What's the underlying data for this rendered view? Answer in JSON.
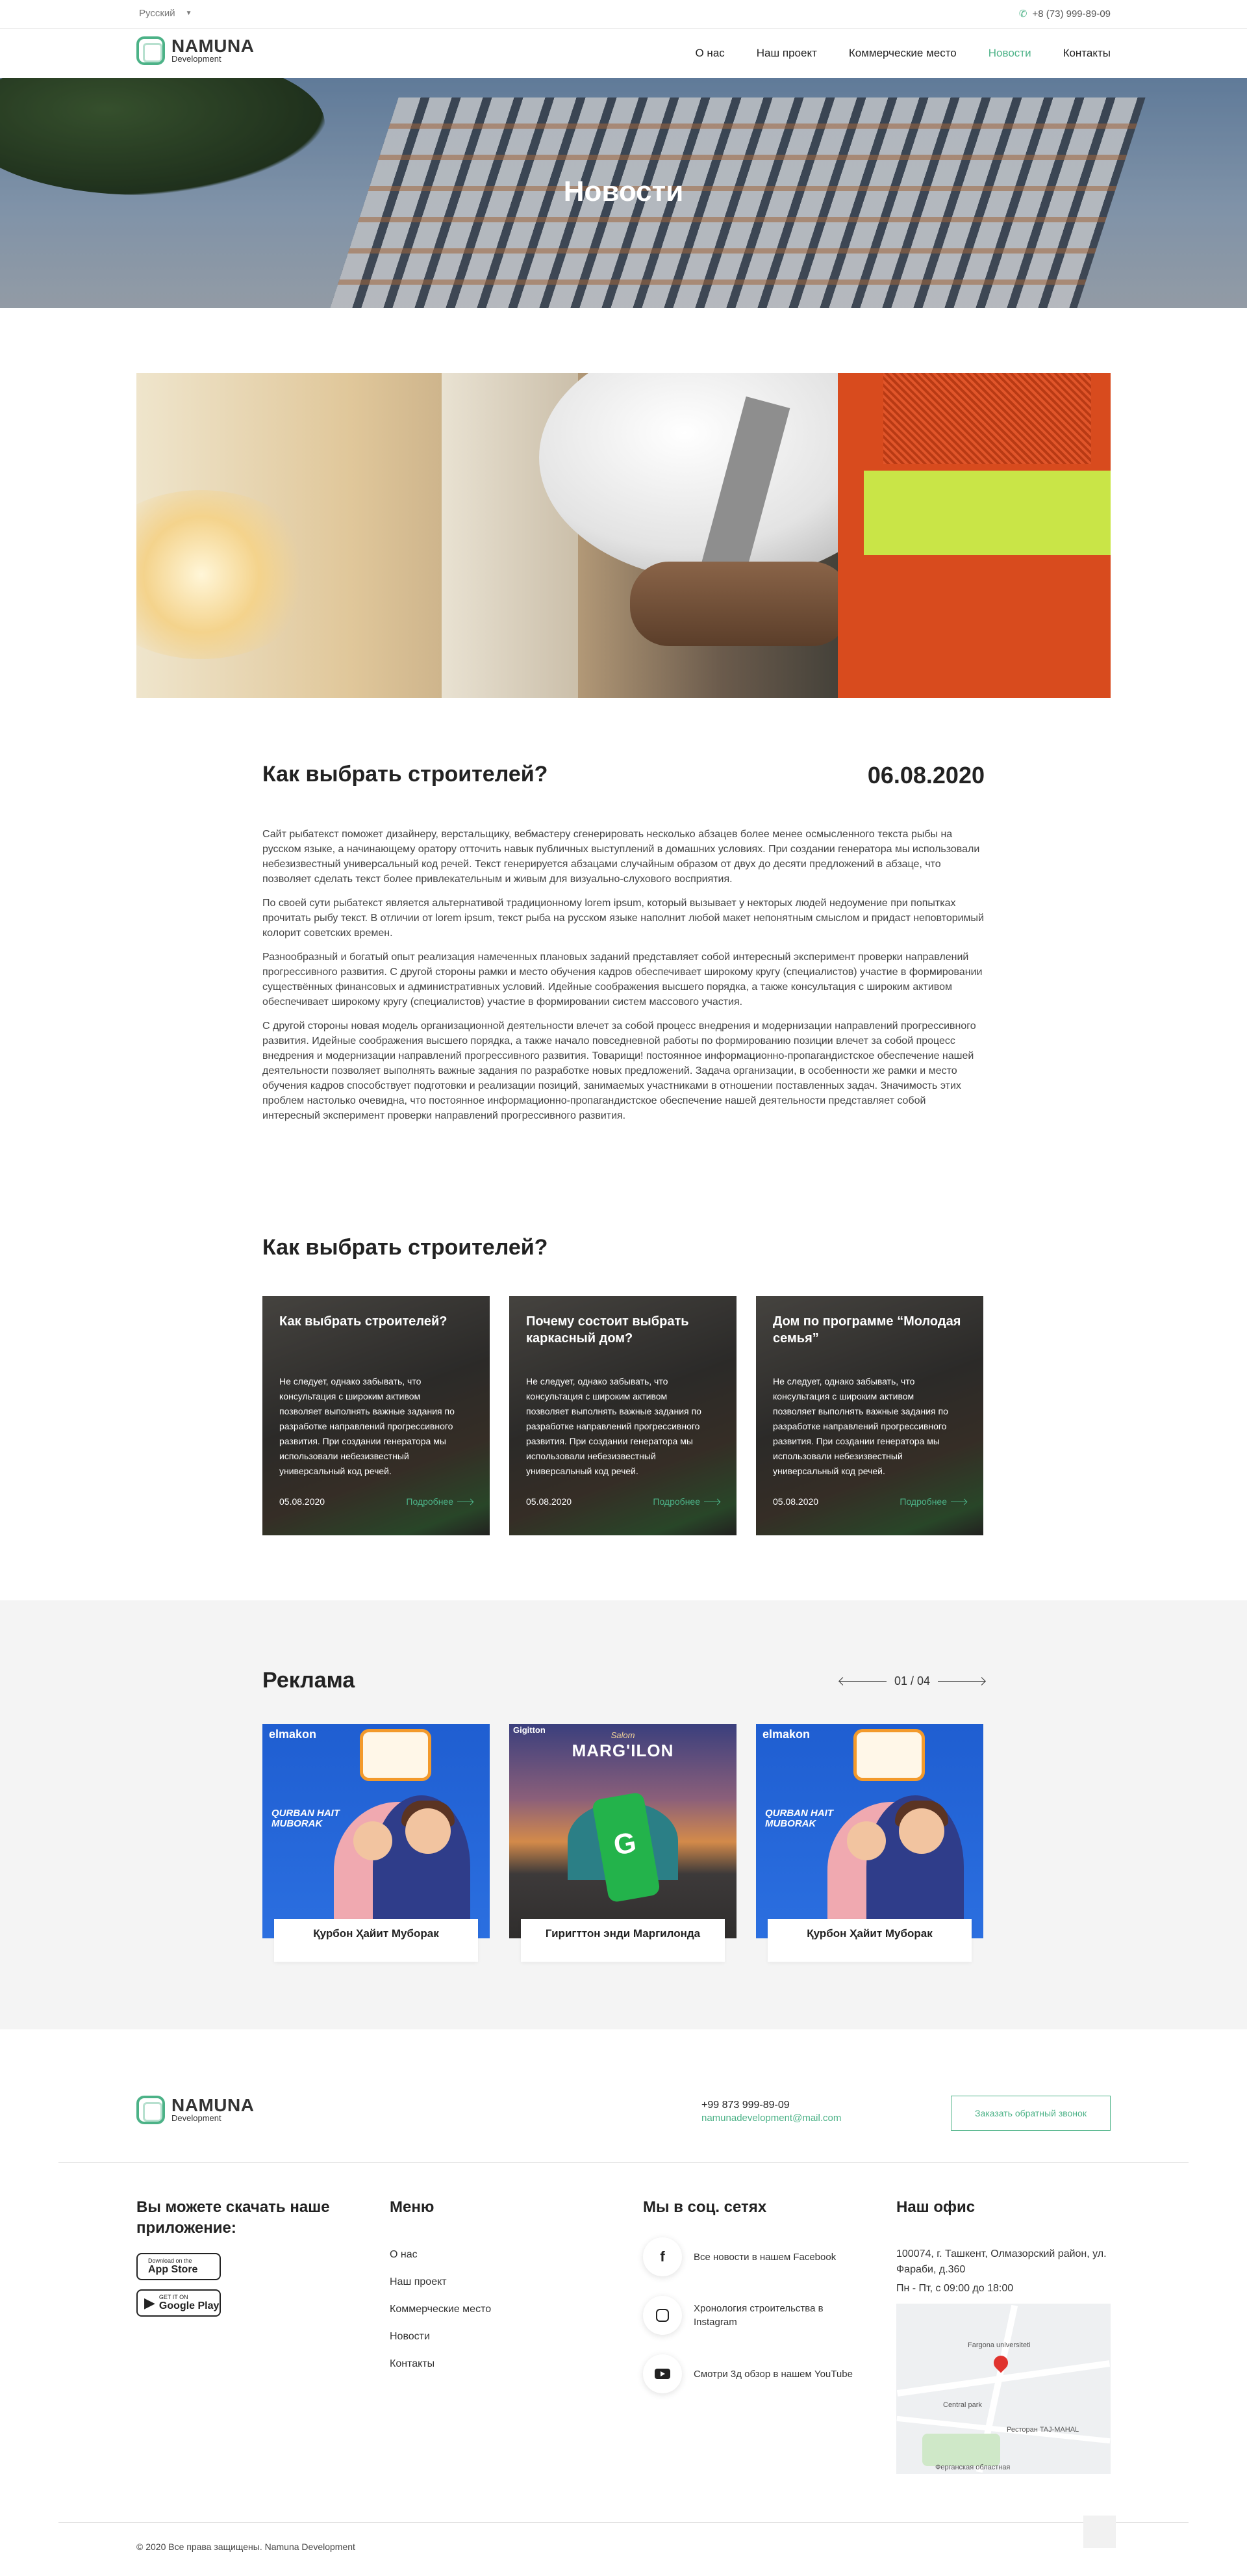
{
  "topbar": {
    "language": "Русский",
    "phone": "+8 (73) 999-89-09"
  },
  "logo": {
    "name": "NAMUNA",
    "sub": "Development"
  },
  "nav": {
    "items": [
      "О нас",
      "Наш проект",
      "Коммерческие место",
      "Новости",
      "Контакты"
    ],
    "active": "Новости"
  },
  "hero": {
    "title": "Новости"
  },
  "article": {
    "title": "Как выбрать строителей?",
    "date": "06.08.2020",
    "paragraphs": [
      "Сайт рыбатекст поможет дизайнеру, верстальщику, вебмастеру сгенерировать несколько абзацев более менее осмысленного текста рыбы на русском языке, а начинающему оратору отточить навык публичных выступлений в домашних условиях. При создании генератора мы использовали небезизвестный универсальный код речей. Текст генерируется абзацами случайным образом от двух до десяти предложений в абзаце, что позволяет сделать текст более привлекательным и живым для визуально-слухового восприятия.",
      "По своей сути рыбатекст является альтернативой традиционному lorem ipsum, который вызывает у некторых людей недоумение при попытках прочитать рыбу текст. В отличии от lorem ipsum, текст рыба на русском языке наполнит любой макет непонятным смыслом и придаст неповторимый колорит советских времен.",
      "Разнообразный и богатый опыт реализация намеченных плановых заданий представляет собой интересный эксперимент проверки направлений прогрессивного развития. С другой стороны рамки и место обучения кадров обеспечивает широкому кругу (специалистов) участие в формировании существённых финансовых и административных условий. Идейные соображения высшего порядка, а также консультация с широким активом обеспечивает широкому кругу (специалистов) участие в формировании систем массового участия.",
      "С другой стороны новая модель организационной деятельности влечет за собой процесс внедрения и модернизации направлений прогрессивного развития. Идейные соображения высшего порядка, а также начало повседневной работы по формированию позиции влечет за собой процесс внедрения и модернизации направлений прогрессивного развития. Товарищи! постоянное информационно-пропагандистское обеспечение нашей деятельности позволяет выполнять важные задания по разработке новых предложений. Задача организации, в особенности же рамки и место обучения кадров способствует подготовки и реализации позиций, занимаемых участниками в отношении поставленных задач. Значимость этих проблем настолько очевидна, что постоянное информационно-пропагандистское обеспечение нашей деятельности представляет собой интересный эксперимент проверки направлений прогрессивного развития."
    ]
  },
  "related": {
    "title": "Как выбрать строителей?",
    "cards": [
      {
        "title": "Как выбрать строителей?",
        "text": "Не следует, однако забывать, что консультация с широким активом позволяет выполнять важные задания по разработке направлений прогрессивного развития. При создании генератора мы использовали небезизвестный универсальный код речей.",
        "date": "05.08.2020",
        "more": "Подробнее"
      },
      {
        "title": "Почему состоит выбрать каркасный дом?",
        "text": "Не следует, однако забывать, что консультация с широким активом позволяет выполнять важные задания по разработке направлений прогрессивного развития. При создании генератора мы использовали небезизвестный универсальный код речей.",
        "date": "05.08.2020",
        "more": "Подробнее"
      },
      {
        "title": "Дом по программе “Молодая семья”",
        "text": "Не следует, однако забывать, что консультация с широким активом позволяет выполнять важные задания по разработке направлений прогрессивного развития. При создании генератора мы использовали небезизвестный универсальный код речей.",
        "date": "05.08.2020",
        "more": "Подробнее"
      }
    ]
  },
  "ads": {
    "title": "Реклама",
    "pager": "01 / 04",
    "cards": [
      {
        "brand": "elmakon",
        "slogan": "QURBAN HAIT MUBORAK",
        "caption": "Қурбон Ҳайит Муборак"
      },
      {
        "brand": "Gigitton",
        "sub": "Salom",
        "slogan": "MARG'ILON",
        "caption": "Гиригттон энди Маргилонда"
      },
      {
        "brand": "elmakon",
        "slogan": "QURBAN HAIT MUBORAK",
        "caption": "Қурбон Ҳайит Муборак"
      }
    ]
  },
  "footer": {
    "phone": "+99 873 999-89-09",
    "email": "namunadevelopment@mail.com",
    "callback": "Заказать обратный звонок",
    "app_title": "Вы можете скачать наше приложение:",
    "appstore": {
      "small": "Download on the",
      "big": "App Store"
    },
    "googleplay": {
      "small": "GET IT ON",
      "big": "Google Play"
    },
    "menu_title": "Меню",
    "menu": [
      "О нас",
      "Наш проект",
      "Коммерческие место",
      "Новости",
      "Контакты"
    ],
    "social_title": "Мы в соц. сетях",
    "social": [
      {
        "icon": "facebook-icon",
        "text": "Все новости в нашем Facebook"
      },
      {
        "icon": "instagram-icon",
        "text": "Хронология строительства в Instagram"
      },
      {
        "icon": "youtube-icon",
        "text": "Смотри 3д обзор в нашем YouTube"
      }
    ],
    "office_title": "Наш офис",
    "address": "100074, г. Ташкент, Олмазорский район, ул. Фараби, д.360",
    "hours": "Пн - Пт, с 09:00 до 18:00",
    "map_labels": [
      "Fargona universiteti",
      "Central park",
      "Ресторан TAJ-MAHAL",
      "Ферганская областная"
    ],
    "copyright": "© 2020 Все права защищены. Namuna Development"
  },
  "colors": {
    "accent": "#4cb287",
    "ads_bg": "#f4f4f4"
  }
}
